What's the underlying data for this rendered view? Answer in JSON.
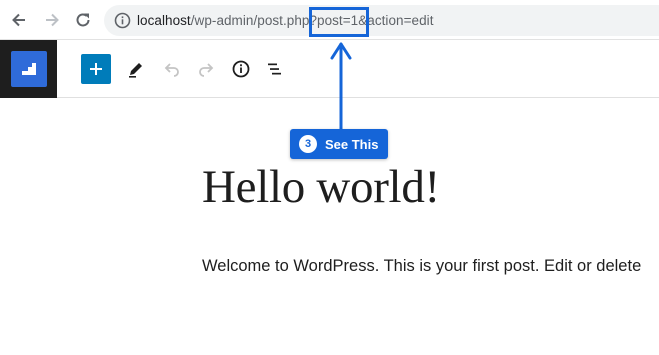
{
  "browser": {
    "url_host": "localhost",
    "url_rest": "/wp-admin/post.php?post=1&action=edit"
  },
  "annotation": {
    "step_number": "3",
    "label": "See This",
    "color": "#1565d8"
  },
  "toolbar": {
    "accent": "#007cba",
    "logo_color": "#2f6bd9",
    "icons": [
      "plus-icon",
      "pencil-icon",
      "undo-icon",
      "redo-icon",
      "info-icon",
      "list-view-icon"
    ]
  },
  "post": {
    "title": "Hello world!",
    "body": "Welcome to WordPress. This is your first post. Edit or delete"
  }
}
